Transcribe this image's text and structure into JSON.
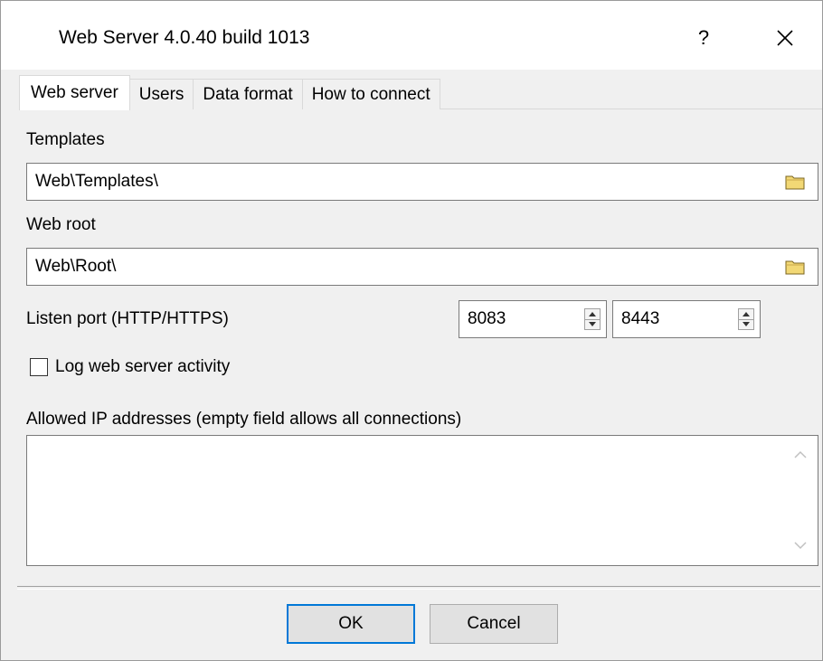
{
  "window": {
    "title": "Web Server 4.0.40 build 1013",
    "help_label": "?",
    "close_glyph": "✕"
  },
  "tabs": [
    {
      "label": "Web server",
      "active": true
    },
    {
      "label": "Users",
      "active": false
    },
    {
      "label": "Data format",
      "active": false
    },
    {
      "label": "How to connect",
      "active": false
    }
  ],
  "templates": {
    "label": "Templates",
    "value": "Web\\Templates\\",
    "browse_icon": "folder-icon"
  },
  "web_root": {
    "label": "Web root",
    "value": "Web\\Root\\",
    "browse_icon": "folder-icon"
  },
  "listen_port": {
    "label": "Listen port (HTTP/HTTPS)",
    "http_value": "8083",
    "https_value": "8443"
  },
  "log_activity": {
    "label": "Log web server activity",
    "checked": false
  },
  "allowed_ips": {
    "label": "Allowed IP addresses (empty field allows all connections)",
    "value": ""
  },
  "buttons": {
    "ok_label": "OK",
    "cancel_label": "Cancel"
  },
  "colors": {
    "accent": "#0078d7",
    "folder": "#f2d875"
  }
}
